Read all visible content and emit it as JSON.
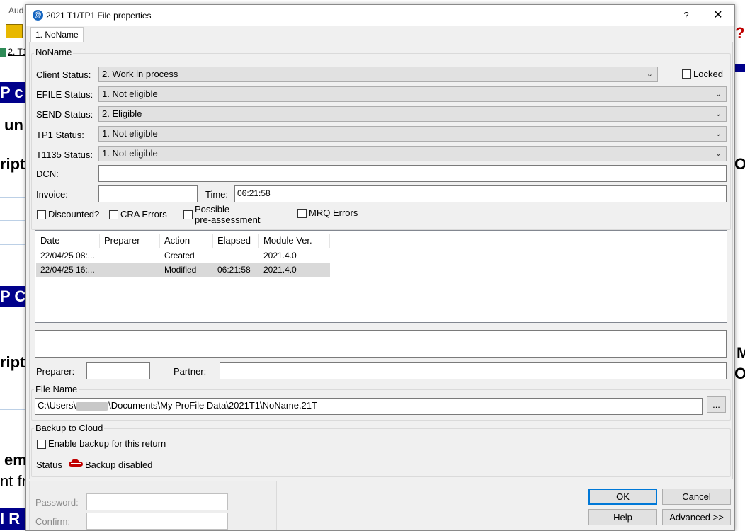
{
  "background": {
    "menu_fragment": "Aud",
    "tab_fragment": "2. T1",
    "fragments": [
      "P c",
      "un",
      "ripti",
      "P C",
      "ripti",
      "em",
      "nt fr",
      "I R",
      "Ov",
      "M",
      "Ov"
    ]
  },
  "dialog": {
    "title": "2021 T1/TP1 File properties",
    "help_glyph": "?",
    "close_glyph": "✕",
    "tab_label": "1. NoName",
    "group_title": "NoName",
    "client_status": {
      "label": "Client Status:",
      "value": "2. Work in process"
    },
    "locked": {
      "label": "Locked",
      "checked": false
    },
    "efile_status": {
      "label": "EFILE Status:",
      "value": "1. Not eligible"
    },
    "send_status": {
      "label": "SEND Status:",
      "value": "2. Eligible"
    },
    "tp1_status": {
      "label": "TP1 Status:",
      "value": "1. Not eligible"
    },
    "t1135_status": {
      "label": "T1135 Status:",
      "value": "1. Not eligible"
    },
    "dcn": {
      "label": "DCN:",
      "value": ""
    },
    "invoice": {
      "label": "Invoice:",
      "value": ""
    },
    "time": {
      "label": "Time:",
      "value": "06:21:58"
    },
    "checkboxes": {
      "discounted": "Discounted?",
      "cra_errors": "CRA Errors",
      "possible_line1": "Possible",
      "possible_line2": "pre-assessment",
      "mrq_errors": "MRQ Errors"
    },
    "history": {
      "columns": [
        "Date",
        "Preparer",
        "Action",
        "Elapsed",
        "Module Ver."
      ],
      "rows": [
        {
          "date": "22/04/25 08:...",
          "preparer": "",
          "action": "Created",
          "elapsed": "",
          "module": "2021.4.0"
        },
        {
          "date": "22/04/25 16:...",
          "preparer": "",
          "action": "Modified",
          "elapsed": "06:21:58",
          "module": "2021.4.0"
        }
      ]
    },
    "notes": "",
    "preparer": {
      "label": "Preparer:",
      "value": ""
    },
    "partner": {
      "label": "Partner:",
      "value": ""
    },
    "file_name": {
      "title": "File Name",
      "path_prefix": "C:\\Users\\",
      "path_suffix": "\\Documents\\My ProFile Data\\2021T1\\NoName.21T",
      "browse": "..."
    },
    "backup": {
      "title": "Backup to Cloud",
      "enable_label": "Enable backup for this return",
      "status_label": "Status",
      "status_text": "Backup disabled",
      "status_icon": "cloud-disabled-icon",
      "status_color": "#c00000"
    },
    "password": {
      "label": "Password:",
      "confirm_label": "Confirm:"
    },
    "buttons": {
      "ok": "OK",
      "cancel": "Cancel",
      "help": "Help",
      "advanced": "Advanced >>"
    }
  }
}
